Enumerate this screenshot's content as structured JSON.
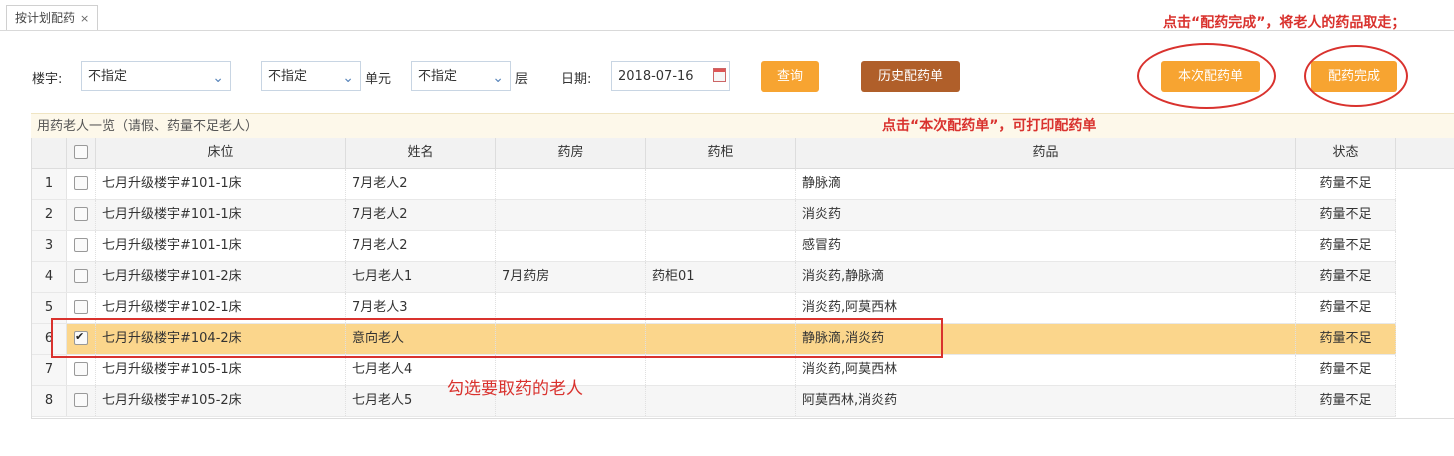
{
  "tab": {
    "label": "按计划配药",
    "close": "×"
  },
  "annotations": {
    "top": "点击“配药完成”，将老人的药品取走；",
    "middle": "点击“本次配药单”，可打印配药单",
    "bottom": "勾选要取药的老人"
  },
  "filters": {
    "building_label": "楼宇:",
    "building_value": "不指定",
    "unit_value": "不指定",
    "unit_label": "单元",
    "floor_value": "不指定",
    "floor_label": "层",
    "date_label": "日期:",
    "date_value": "2018-07-16"
  },
  "buttons": {
    "query": "查询",
    "history": "历史配药单",
    "current": "本次配药单",
    "complete": "配药完成"
  },
  "section_title": "用药老人一览（请假、药量不足老人）",
  "table": {
    "headers": {
      "bed": "床位",
      "name": "姓名",
      "pharmacy": "药房",
      "cabinet": "药柜",
      "drugs": "药品",
      "status": "状态"
    },
    "rows": [
      {
        "n": "1",
        "bed": "七月升级楼宇#101-1床",
        "name": "7月老人2",
        "pharmacy": "",
        "cabinet": "",
        "drugs": "静脉滴",
        "status": "药量不足",
        "checked": false
      },
      {
        "n": "2",
        "bed": "七月升级楼宇#101-1床",
        "name": "7月老人2",
        "pharmacy": "",
        "cabinet": "",
        "drugs": "消炎药",
        "status": "药量不足",
        "checked": false
      },
      {
        "n": "3",
        "bed": "七月升级楼宇#101-1床",
        "name": "7月老人2",
        "pharmacy": "",
        "cabinet": "",
        "drugs": "感冒药",
        "status": "药量不足",
        "checked": false
      },
      {
        "n": "4",
        "bed": "七月升级楼宇#101-2床",
        "name": "七月老人1",
        "pharmacy": "7月药房",
        "cabinet": "药柜01",
        "drugs": "消炎药,静脉滴",
        "status": "药量不足",
        "checked": false
      },
      {
        "n": "5",
        "bed": "七月升级楼宇#102-1床",
        "name": "7月老人3",
        "pharmacy": "",
        "cabinet": "",
        "drugs": "消炎药,阿莫西林",
        "status": "药量不足",
        "checked": false
      },
      {
        "n": "6",
        "bed": "七月升级楼宇#104-2床",
        "name": "意向老人",
        "pharmacy": "",
        "cabinet": "",
        "drugs": "静脉滴,消炎药",
        "status": "药量不足",
        "checked": true
      },
      {
        "n": "7",
        "bed": "七月升级楼宇#105-1床",
        "name": "七月老人4",
        "pharmacy": "",
        "cabinet": "",
        "drugs": "消炎药,阿莫西林",
        "status": "药量不足",
        "checked": false
      },
      {
        "n": "8",
        "bed": "七月升级楼宇#105-2床",
        "name": "七月老人5",
        "pharmacy": "",
        "cabinet": "",
        "drugs": "阿莫西林,消炎药",
        "status": "药量不足",
        "checked": false
      }
    ]
  },
  "colors": {
    "accent": "#f7a431",
    "brown": "#b05f2a",
    "annotation": "#d9322e",
    "selected_row": "#fbd68c"
  }
}
